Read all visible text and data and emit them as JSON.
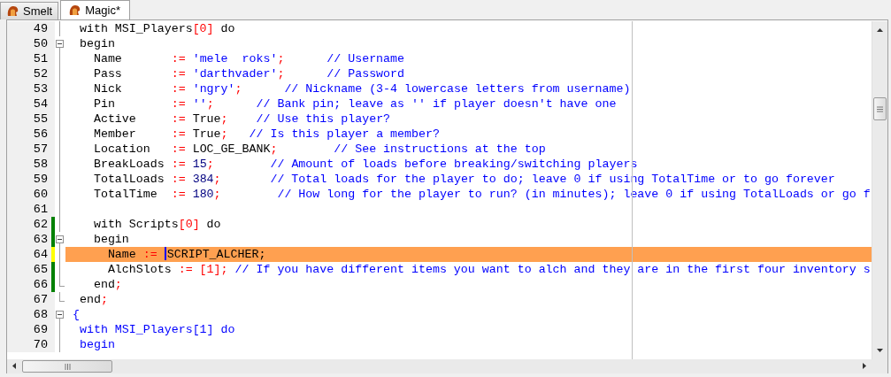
{
  "tabs": [
    {
      "label": "Smelt",
      "selected": false
    },
    {
      "label": "Magic*",
      "selected": true
    }
  ],
  "editor": {
    "lines": [
      {
        "number": "49",
        "saved_change": false,
        "unsaved_change": false,
        "fold_start": false,
        "fold_end": false,
        "highlighted": false,
        "segments": [
          {
            "text": "  with MSI_Players",
            "kind": "plain"
          },
          {
            "text": "[0]",
            "kind": "symbol"
          },
          {
            "text": " do",
            "kind": "plain"
          }
        ]
      },
      {
        "number": "50",
        "saved_change": false,
        "unsaved_change": false,
        "fold_start": true,
        "fold_end": false,
        "highlighted": false,
        "segments": [
          {
            "text": "  begin",
            "kind": "plain"
          }
        ]
      },
      {
        "number": "51",
        "saved_change": false,
        "unsaved_change": false,
        "fold_start": false,
        "fold_end": false,
        "highlighted": false,
        "segments": [
          {
            "text": "    Name       ",
            "kind": "plain"
          },
          {
            "text": ":=",
            "kind": "symbol"
          },
          {
            "text": " 'mele  roks'",
            "kind": "string"
          },
          {
            "text": ";",
            "kind": "symbol"
          },
          {
            "text": "      // Username",
            "kind": "comment"
          }
        ]
      },
      {
        "number": "52",
        "saved_change": false,
        "unsaved_change": false,
        "fold_start": false,
        "fold_end": false,
        "highlighted": false,
        "segments": [
          {
            "text": "    Pass       ",
            "kind": "plain"
          },
          {
            "text": ":=",
            "kind": "symbol"
          },
          {
            "text": " 'darthvader'",
            "kind": "string"
          },
          {
            "text": ";",
            "kind": "symbol"
          },
          {
            "text": "      // Password",
            "kind": "comment"
          }
        ]
      },
      {
        "number": "53",
        "saved_change": false,
        "unsaved_change": false,
        "fold_start": false,
        "fold_end": false,
        "highlighted": false,
        "segments": [
          {
            "text": "    Nick       ",
            "kind": "plain"
          },
          {
            "text": ":=",
            "kind": "symbol"
          },
          {
            "text": " 'ngry'",
            "kind": "string"
          },
          {
            "text": ";",
            "kind": "symbol"
          },
          {
            "text": "      // Nickname (3-4 lowercase letters from username)",
            "kind": "comment"
          }
        ]
      },
      {
        "number": "54",
        "saved_change": false,
        "unsaved_change": false,
        "fold_start": false,
        "fold_end": false,
        "highlighted": false,
        "segments": [
          {
            "text": "    Pin        ",
            "kind": "plain"
          },
          {
            "text": ":=",
            "kind": "symbol"
          },
          {
            "text": " ''",
            "kind": "string"
          },
          {
            "text": ";",
            "kind": "symbol"
          },
          {
            "text": "      // Bank pin; leave as '' if player doesn't have one",
            "kind": "comment"
          }
        ]
      },
      {
        "number": "55",
        "saved_change": false,
        "unsaved_change": false,
        "fold_start": false,
        "fold_end": false,
        "highlighted": false,
        "segments": [
          {
            "text": "    Active     ",
            "kind": "plain"
          },
          {
            "text": ":=",
            "kind": "symbol"
          },
          {
            "text": " True",
            "kind": "plain"
          },
          {
            "text": ";",
            "kind": "symbol"
          },
          {
            "text": "    // Use this player?",
            "kind": "comment"
          }
        ]
      },
      {
        "number": "56",
        "saved_change": false,
        "unsaved_change": false,
        "fold_start": false,
        "fold_end": false,
        "highlighted": false,
        "segments": [
          {
            "text": "    Member     ",
            "kind": "plain"
          },
          {
            "text": ":=",
            "kind": "symbol"
          },
          {
            "text": " True",
            "kind": "plain"
          },
          {
            "text": ";",
            "kind": "symbol"
          },
          {
            "text": "   // Is this player a member?",
            "kind": "comment"
          }
        ]
      },
      {
        "number": "57",
        "saved_change": false,
        "unsaved_change": false,
        "fold_start": false,
        "fold_end": false,
        "highlighted": false,
        "segments": [
          {
            "text": "    Location   ",
            "kind": "plain"
          },
          {
            "text": ":=",
            "kind": "symbol"
          },
          {
            "text": " LOC_GE_BANK",
            "kind": "plain"
          },
          {
            "text": ";",
            "kind": "symbol"
          },
          {
            "text": "        // See instructions at the top",
            "kind": "comment"
          }
        ]
      },
      {
        "number": "58",
        "saved_change": false,
        "unsaved_change": false,
        "fold_start": false,
        "fold_end": false,
        "highlighted": false,
        "segments": [
          {
            "text": "    BreakLoads ",
            "kind": "plain"
          },
          {
            "text": ":=",
            "kind": "symbol"
          },
          {
            "text": " 15",
            "kind": "number"
          },
          {
            "text": ";",
            "kind": "symbol"
          },
          {
            "text": "        // Amount of loads before breaking/switching players",
            "kind": "comment"
          }
        ]
      },
      {
        "number": "59",
        "saved_change": false,
        "unsaved_change": false,
        "fold_start": false,
        "fold_end": false,
        "highlighted": false,
        "segments": [
          {
            "text": "    TotalLoads ",
            "kind": "plain"
          },
          {
            "text": ":=",
            "kind": "symbol"
          },
          {
            "text": " 384",
            "kind": "number"
          },
          {
            "text": ";",
            "kind": "symbol"
          },
          {
            "text": "       // Total loads for the player to do; leave 0 if using TotalTime or to go forever",
            "kind": "comment"
          }
        ]
      },
      {
        "number": "60",
        "saved_change": false,
        "unsaved_change": false,
        "fold_start": false,
        "fold_end": false,
        "highlighted": false,
        "segments": [
          {
            "text": "    TotalTime  ",
            "kind": "plain"
          },
          {
            "text": ":=",
            "kind": "symbol"
          },
          {
            "text": " 180",
            "kind": "number"
          },
          {
            "text": ";",
            "kind": "symbol"
          },
          {
            "text": "        // How long for the player to run? (in minutes); leave 0 if using TotalLoads or go f",
            "kind": "comment"
          }
        ]
      },
      {
        "number": "61",
        "saved_change": false,
        "unsaved_change": false,
        "fold_start": false,
        "fold_end": false,
        "highlighted": false
      },
      {
        "number": "62",
        "saved_change": true,
        "unsaved_change": false,
        "fold_start": false,
        "fold_end": false,
        "highlighted": false,
        "segments": [
          {
            "text": "    with Scripts",
            "kind": "plain"
          },
          {
            "text": "[0]",
            "kind": "symbol"
          },
          {
            "text": " do",
            "kind": "plain"
          }
        ]
      },
      {
        "number": "63",
        "saved_change": true,
        "unsaved_change": false,
        "fold_start": true,
        "fold_end": false,
        "highlighted": false,
        "segments": [
          {
            "text": "    begin",
            "kind": "plain"
          }
        ]
      },
      {
        "number": "64",
        "saved_change": false,
        "unsaved_change": true,
        "fold_start": false,
        "fold_end": false,
        "highlighted": true,
        "segments": [
          {
            "text": "      Name ",
            "kind": "plain"
          },
          {
            "text": ":= ",
            "kind": "symbol"
          },
          {
            "kind": "caret"
          },
          {
            "text": "SCRIPT_ALCHER;",
            "kind": "plain"
          }
        ]
      },
      {
        "number": "65",
        "saved_change": true,
        "unsaved_change": false,
        "fold_start": false,
        "fold_end": false,
        "highlighted": false,
        "segments": [
          {
            "text": "      AlchSlots ",
            "kind": "plain"
          },
          {
            "text": ":= [1];",
            "kind": "symbol"
          },
          {
            "text": " // If you have different items you want to alch and they are in the first four inventory s",
            "kind": "comment"
          }
        ]
      },
      {
        "number": "66",
        "saved_change": true,
        "unsaved_change": false,
        "fold_start": false,
        "fold_end": true,
        "highlighted": false,
        "segments": [
          {
            "text": "    end",
            "kind": "plain"
          },
          {
            "text": ";",
            "kind": "symbol"
          }
        ]
      },
      {
        "number": "67",
        "saved_change": false,
        "unsaved_change": false,
        "fold_start": false,
        "fold_end": true,
        "highlighted": false,
        "segments": [
          {
            "text": "  end",
            "kind": "plain"
          },
          {
            "text": ";",
            "kind": "symbol"
          }
        ]
      },
      {
        "number": "68",
        "saved_change": false,
        "unsaved_change": false,
        "fold_start": true,
        "fold_end": false,
        "highlighted": false,
        "segments": [
          {
            "text": " {",
            "kind": "comment"
          }
        ]
      },
      {
        "number": "69",
        "saved_change": false,
        "unsaved_change": false,
        "fold_start": false,
        "fold_end": false,
        "highlighted": false,
        "segments": [
          {
            "text": "  with MSI_Players[1] do",
            "kind": "comment"
          }
        ]
      },
      {
        "number": "70",
        "saved_change": false,
        "unsaved_change": false,
        "fold_start": false,
        "fold_end": false,
        "highlighted": false,
        "segments": [
          {
            "text": "  begin",
            "kind": "comment"
          }
        ]
      }
    ]
  }
}
